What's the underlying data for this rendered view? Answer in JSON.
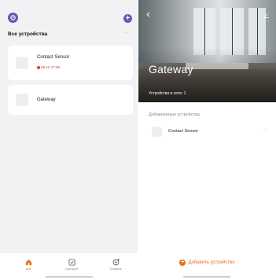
{
  "left_screen": {
    "header": {
      "title": "Все устройства",
      "more": "···",
      "add": "+"
    },
    "devices": [
      {
        "name": "Contact Sensor",
        "status": "09-10 17:08",
        "status_color": "#e03535"
      },
      {
        "name": "Gateway"
      }
    ],
    "bottom_nav": [
      {
        "label": "Дом",
        "icon": "home-icon",
        "active": true
      },
      {
        "label": "Сценарий",
        "icon": "scene-check-icon"
      },
      {
        "label": "Профиль",
        "icon": "profile-icon"
      }
    ]
  },
  "right_screen": {
    "gateway_title": "Gateway",
    "online_devices": "Устройства в сети: 1",
    "section_label": "Добавленные устройства",
    "devices": [
      {
        "name": "Contact Sensor",
        "more": "···"
      }
    ],
    "add_device_label": "Добавить устройство"
  },
  "colors": {
    "accent_purple": "#6a55b4",
    "accent_orange": "#ef6a1e",
    "status_red": "#e03535",
    "background_gray": "#f2f2f5"
  }
}
